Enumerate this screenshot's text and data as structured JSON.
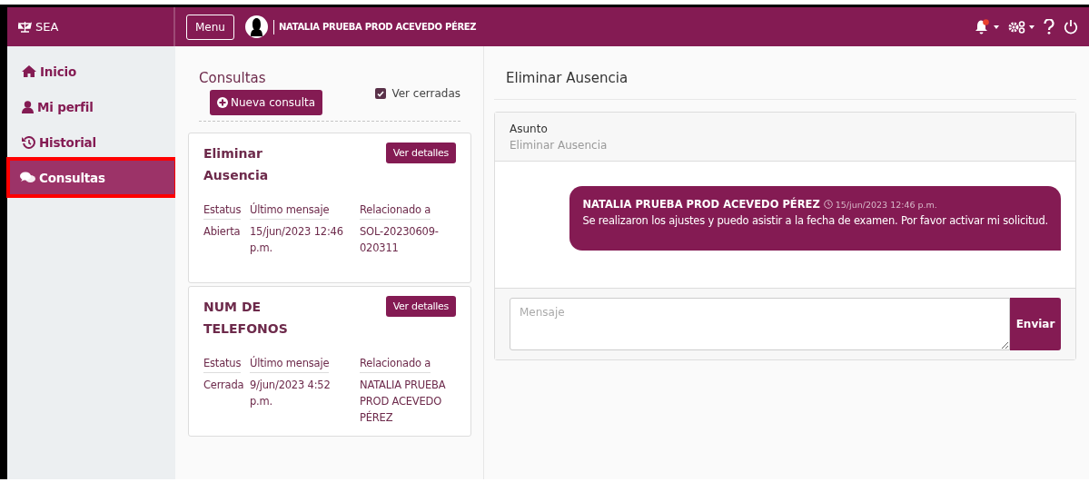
{
  "brand": "SEA",
  "topbar": {
    "menu_button": "Menu",
    "user_name": "NATALIA PRUEBA PROD ACEVEDO PÉREZ",
    "notifications_unread": true
  },
  "sidebar": {
    "items": [
      {
        "label": "Inicio",
        "selected": false,
        "highlighted": false
      },
      {
        "label": "Mi perfil",
        "selected": false,
        "highlighted": false
      },
      {
        "label": "Historial",
        "selected": false,
        "highlighted": false
      },
      {
        "label": "Consultas",
        "selected": true,
        "highlighted": true
      }
    ]
  },
  "consultas": {
    "title": "Consultas",
    "show_closed": {
      "label": "Ver cerradas",
      "checked": true
    },
    "new_button": "Nueva consulta",
    "cards": [
      {
        "title": "Eliminar Ausencia",
        "button": "Ver detalles",
        "columns": [
          "Estatus",
          "Último mensaje",
          "Relacionado a"
        ],
        "values": [
          "Abierta",
          "15/jun/2023 12:46 p.m.",
          "SOL-20230609-020311"
        ]
      },
      {
        "title": "NUM DE TELEFONOS",
        "button": "Ver detalles",
        "columns": [
          "Estatus",
          "Último mensaje",
          "Relacionado a"
        ],
        "values": [
          "Cerrada",
          "9/jun/2023 4:52 p.m.",
          "NATALIA PRUEBA PROD ACEVEDO PÉREZ"
        ]
      }
    ]
  },
  "detail": {
    "title": "Eliminar Ausencia",
    "subject_label": "Asunto",
    "subject": "Eliminar Ausencia",
    "messages": [
      {
        "author": "NATALIA PRUEBA PROD ACEVEDO PÉREZ",
        "time": "15/jun/2023 12:46 p.m.",
        "text": "Se realizaron los ajustes y puedo asistir a la fecha de examen. Por favor activar mi solicitud."
      }
    ],
    "input": {
      "placeholder": "Mensaje"
    },
    "send_button": "Enviar"
  }
}
